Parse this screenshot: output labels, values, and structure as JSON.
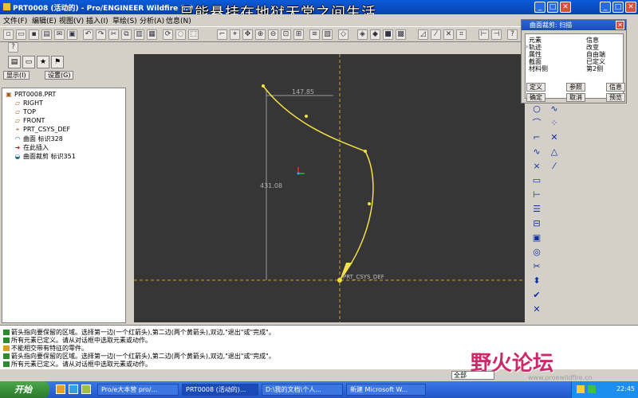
{
  "window": {
    "title": "PRT0008 (活动的) - Pro/ENGINEER Wildfire 3.0"
  },
  "overlay_text": "只能悬挂在地狱天堂之间生活",
  "menu": [
    "文件(F)",
    "编辑(E)",
    "视图(V)",
    "插入(I)",
    "草绘(S)",
    "分析(A)",
    "信息(N)"
  ],
  "panel_buttons": {
    "display": "显示(I)",
    "settings": "设置(G)"
  },
  "tree": [
    {
      "label": "PRT0008.PRT",
      "icon": "part-icon"
    },
    {
      "label": "RIGHT",
      "icon": "datum-plane-icon"
    },
    {
      "label": "TOP",
      "icon": "datum-plane-icon"
    },
    {
      "label": "FRONT",
      "icon": "datum-plane-icon"
    },
    {
      "label": "PRT_CSYS_DEF",
      "icon": "csys-icon"
    },
    {
      "label": "曲面 标识328",
      "icon": "surface-icon"
    },
    {
      "label": "在此插入",
      "icon": "insert-arrow-icon"
    },
    {
      "label": "曲面裁剪 标识351",
      "icon": "trim-icon"
    }
  ],
  "sketch": {
    "dim_horizontal": "147.85",
    "dim_vertical": "431.08",
    "csys_label": "PRT_CSYS_DEF"
  },
  "dialog": {
    "title": "曲面裁剪: 扫描",
    "col_element": "元素",
    "col_info": "信息",
    "rows": [
      {
        "element": "轨迹",
        "info": "改变"
      },
      {
        "element": "属性",
        "info": "自由端"
      },
      {
        "element": "截面",
        "info": "已定义"
      },
      {
        "element": "材料侧",
        "info": "第2侧"
      }
    ],
    "buttons": {
      "define": "定义",
      "reference": "参照",
      "info": "信息",
      "ok": "确定",
      "cancel": "取消",
      "preview": "预览"
    }
  },
  "messages": [
    "箭头指向要保留的区域。选择第一边(一个红箭头),第二边(两个黄箭头),双边,\"退出\"或\"完成\"。",
    "所有元素已定义。请从对话框中选取元素或动作。",
    "不能相交带有特征的零件。",
    "箭头指向要保留的区域。选择第一边(一个红箭头),第二边(两个黄箭头),双边,\"退出\"或\"完成\"。",
    "所有元素已定义。请从对话框中选取元素或动作。"
  ],
  "filter": "全部",
  "logo": {
    "text": "野火论坛",
    "url": "www.proewildfire.cn"
  },
  "taskbar": {
    "start": "开始",
    "tasks": [
      "Pro/e大本营 pro/...",
      "PRT0008 (活动的)...",
      "D:\\我的文档\\个人...",
      "新建 Microsoft W..."
    ],
    "clock": "22:45"
  }
}
